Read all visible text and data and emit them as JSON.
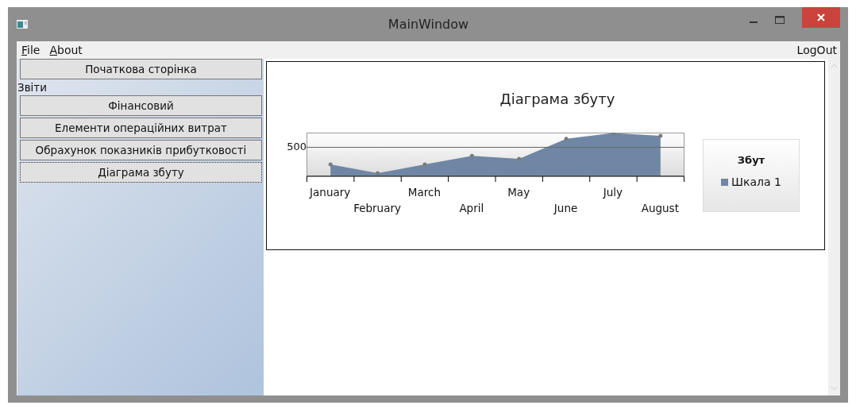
{
  "window": {
    "title": "MainWindow"
  },
  "menu": [
    {
      "label": "File"
    },
    {
      "label": "About"
    }
  ],
  "logout": "LogOut",
  "sidebar": {
    "items": [
      {
        "kind": "button",
        "label": "Початкова сторінка",
        "focused": false
      },
      {
        "kind": "label",
        "label": "Звіти"
      },
      {
        "kind": "button",
        "label": "Фінансовий",
        "focused": false
      },
      {
        "kind": "button",
        "label": "Елементи операційних витрат",
        "focused": false
      },
      {
        "kind": "button",
        "label": "Обрахунок показників прибутковості",
        "focused": false
      },
      {
        "kind": "button",
        "label": "Діаграма збуту",
        "focused": true
      }
    ]
  },
  "chart": {
    "chart_data": {
      "type": "area",
      "title": "Діаграма збуту",
      "categories": [
        "January",
        "February",
        "March",
        "April",
        "May",
        "June",
        "July",
        "August"
      ],
      "series": [
        {
          "name": "Шкала 1",
          "color": "#6f87a5",
          "values": [
            200,
            50,
            200,
            350,
            300,
            650,
            750,
            700
          ]
        }
      ],
      "ylim": [
        0,
        750
      ],
      "yticks": [
        500
      ]
    },
    "legend_title": "Збут"
  }
}
